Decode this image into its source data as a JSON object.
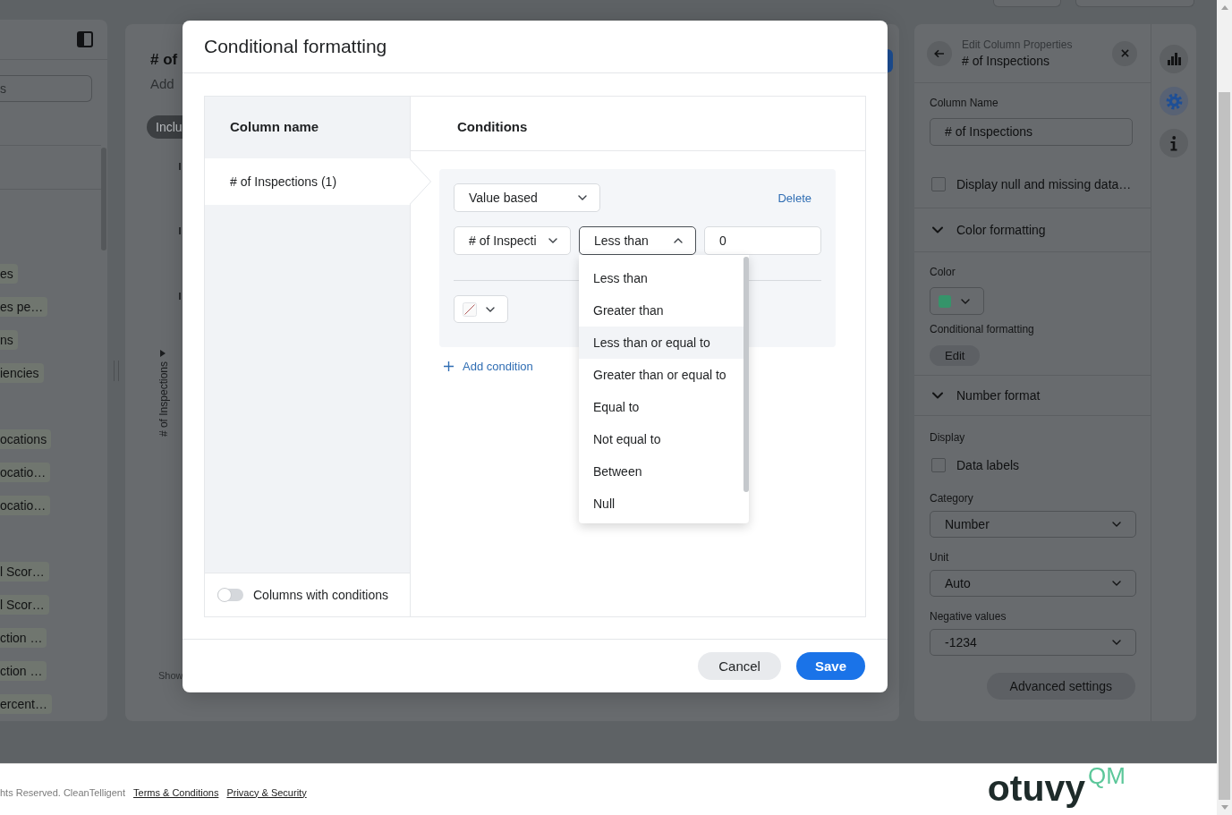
{
  "left_panel": {
    "search": {
      "placeholder": "s"
    },
    "field_groups": [
      [
        "es",
        "es pe…",
        "ns",
        "iencies"
      ],
      [
        "ocations",
        "ocatio…",
        "ocatio…"
      ],
      [
        "l Scor…",
        "l Scor…",
        "ction …",
        "ction …",
        "ercent…"
      ]
    ]
  },
  "center_panel": {
    "title": "# of",
    "subtitle": "Add",
    "filter_pill": "Inclu",
    "axis_label": "# of Inspections",
    "footer_text": "Show"
  },
  "properties_panel": {
    "heading": "Edit Column Properties",
    "column_title": "# of Inspections",
    "column_name": {
      "label": "Column Name",
      "value": "# of Inspections"
    },
    "display_null": {
      "label": "Display null and missing data…",
      "checked": false
    },
    "color_formatting": {
      "title": "Color formatting",
      "expanded": true,
      "color_label": "Color",
      "color": "#35946a",
      "conditional_label": "Conditional formatting",
      "edit_button": "Edit"
    },
    "number_format": {
      "title": "Number format",
      "expanded": true,
      "display_label": "Display",
      "data_labels": {
        "label": "Data labels",
        "checked": false
      },
      "selects": [
        {
          "label": "Category",
          "value": "Number"
        },
        {
          "label": "Unit",
          "value": "Auto"
        },
        {
          "label": "Negative values",
          "value": "-1234"
        }
      ],
      "advanced_button": "Advanced settings"
    },
    "rail": [
      {
        "kind": "chart",
        "selected": false
      },
      {
        "kind": "settings",
        "selected": true
      },
      {
        "kind": "info",
        "selected": false
      }
    ]
  },
  "modal": {
    "title": "Conditional formatting",
    "column_header": "Column name",
    "columns": [
      {
        "label": "# of Inspections (1)",
        "selected": true
      }
    ],
    "columns_toggle": {
      "label": "Columns with conditions",
      "on": false
    },
    "conditions_header": "Conditions",
    "conditions": [
      {
        "rule_type": "Value based",
        "delete_link": "Delete",
        "column": "# of Inspecti",
        "operator": "Less than",
        "operator_open": true,
        "operator_options": [
          {
            "label": "Less than",
            "highlighted": false
          },
          {
            "label": "Greater than",
            "highlighted": false
          },
          {
            "label": "Less than or equal to",
            "highlighted": true
          },
          {
            "label": "Greater than or equal to",
            "highlighted": false
          },
          {
            "label": "Equal to",
            "highlighted": false
          },
          {
            "label": "Not equal to",
            "highlighted": false
          },
          {
            "label": "Between",
            "highlighted": false
          },
          {
            "label": "Null",
            "highlighted": false
          }
        ],
        "value": "0"
      }
    ],
    "add_condition": "Add condition",
    "buttons": [
      {
        "label": "Cancel",
        "kind": "secondary"
      },
      {
        "label": "Save",
        "kind": "primary"
      }
    ]
  },
  "footer": {
    "copyright": "hts Reserved. CleanTelligent",
    "links": [
      "Terms & Conditions",
      "Privacy & Security"
    ],
    "logo": {
      "wordmark": "otuvy",
      "suffix": "QM"
    }
  }
}
